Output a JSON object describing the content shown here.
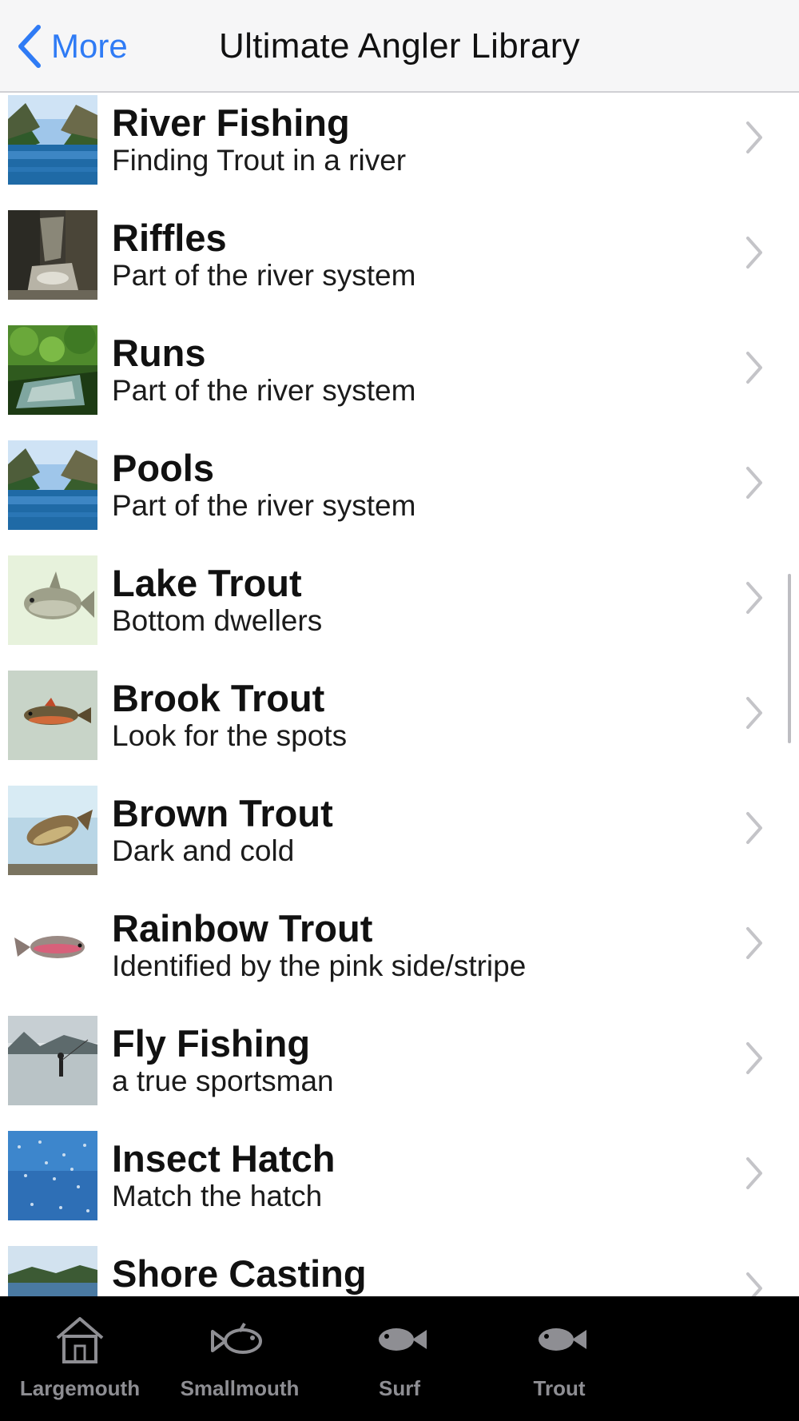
{
  "navbar": {
    "back_label": "More",
    "title": "Ultimate Angler Library"
  },
  "list": {
    "items": [
      {
        "title": "River Fishing",
        "subtitle": "Finding Trout in a river",
        "thumb": "mountain-river"
      },
      {
        "title": "Riffles",
        "subtitle": "Part of the river system",
        "thumb": "rocky-stream"
      },
      {
        "title": "Runs",
        "subtitle": "Part of the river system",
        "thumb": "forest-stream"
      },
      {
        "title": "Pools",
        "subtitle": "Part of the river system",
        "thumb": "mountain-river"
      },
      {
        "title": "Lake Trout",
        "subtitle": "Bottom dwellers",
        "thumb": "lake-trout"
      },
      {
        "title": "Brook Trout",
        "subtitle": "Look for the spots",
        "thumb": "brook-trout"
      },
      {
        "title": "Brown Trout",
        "subtitle": "Dark and cold",
        "thumb": "brown-trout"
      },
      {
        "title": "Rainbow Trout",
        "subtitle": "Identified by the pink side/stripe",
        "thumb": "rainbow-trout"
      },
      {
        "title": "Fly Fishing",
        "subtitle": "a true sportsman",
        "thumb": "fly-fisher"
      },
      {
        "title": "Insect Hatch",
        "subtitle": "Match the hatch",
        "thumb": "insect-hatch"
      },
      {
        "title": "Shore Casting",
        "subtitle": "",
        "thumb": "shoreline"
      }
    ]
  },
  "tabbar": {
    "tabs": [
      {
        "label": "Largemouth",
        "icon": "house-icon"
      },
      {
        "label": "Smallmouth",
        "icon": "fish-outline-icon"
      },
      {
        "label": "Surf",
        "icon": "fish-icon"
      },
      {
        "label": "Trout",
        "icon": "fish-icon"
      }
    ]
  },
  "colors": {
    "accent": "#2f7bf5",
    "navbar_bg": "#f6f6f7",
    "tabbar_bg": "#000000",
    "tab_inactive": "#8e8e93"
  }
}
